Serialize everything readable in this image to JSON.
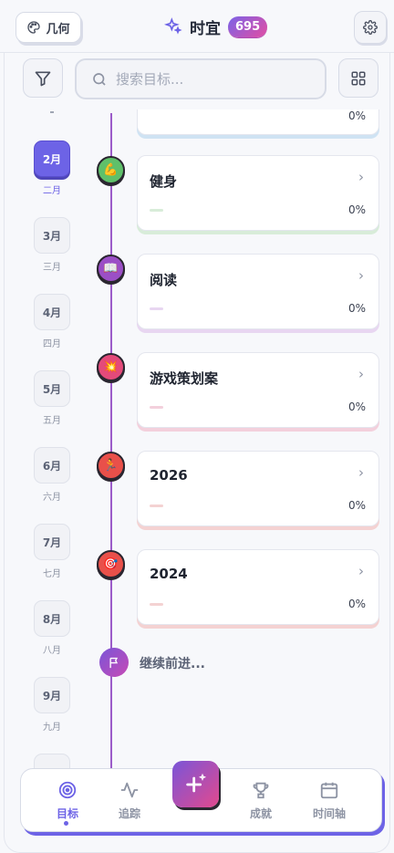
{
  "header": {
    "theme_label": "几何",
    "title": "时宜",
    "points": "695"
  },
  "search": {
    "placeholder": "搜索目标..."
  },
  "months": {
    "items": [
      {
        "label": "2月",
        "sub": "二月",
        "active": true
      },
      {
        "label": "3月",
        "sub": "三月",
        "active": false
      },
      {
        "label": "4月",
        "sub": "四月",
        "active": false
      },
      {
        "label": "5月",
        "sub": "五月",
        "active": false
      },
      {
        "label": "6月",
        "sub": "六月",
        "active": false
      },
      {
        "label": "7月",
        "sub": "七月",
        "active": false
      },
      {
        "label": "8月",
        "sub": "八月",
        "active": false
      },
      {
        "label": "9月",
        "sub": "九月",
        "active": false
      }
    ]
  },
  "timeline": {
    "partial_percent": "0%",
    "goals": [
      {
        "title": "健身",
        "percent": "0%",
        "progress": 0,
        "node_color": "#5fc06a",
        "accent": "#d8ecd9",
        "icon": "flexed-biceps-icon",
        "glyph": "💪"
      },
      {
        "title": "阅读",
        "percent": "0%",
        "progress": 0,
        "node_color": "#9b4fc6",
        "accent": "#e8d6f1",
        "icon": "book-icon",
        "glyph": "📖"
      },
      {
        "title": "游戏策划案",
        "percent": "0%",
        "progress": 0,
        "node_color": "#e44a7a",
        "accent": "#f3d0dc",
        "icon": "sparkle-burst-icon",
        "glyph": "💥"
      },
      {
        "title": "2026",
        "percent": "0%",
        "progress": 0,
        "node_color": "#e9504a",
        "accent": "#f4d2d2",
        "icon": "runner-icon",
        "glyph": "🏃"
      },
      {
        "title": "2024",
        "percent": "0%",
        "progress": 0,
        "node_color": "#e9504a",
        "accent": "#f4d2d2",
        "icon": "target-icon",
        "glyph": "🎯"
      }
    ],
    "continue_label": "继续前进..."
  },
  "nav": {
    "goals": "目标",
    "track": "追踪",
    "achievements": "成就",
    "timeline": "时间轴"
  },
  "colors": {
    "accent": "#6d63e6",
    "timeline_line": "#9b5bc9"
  }
}
